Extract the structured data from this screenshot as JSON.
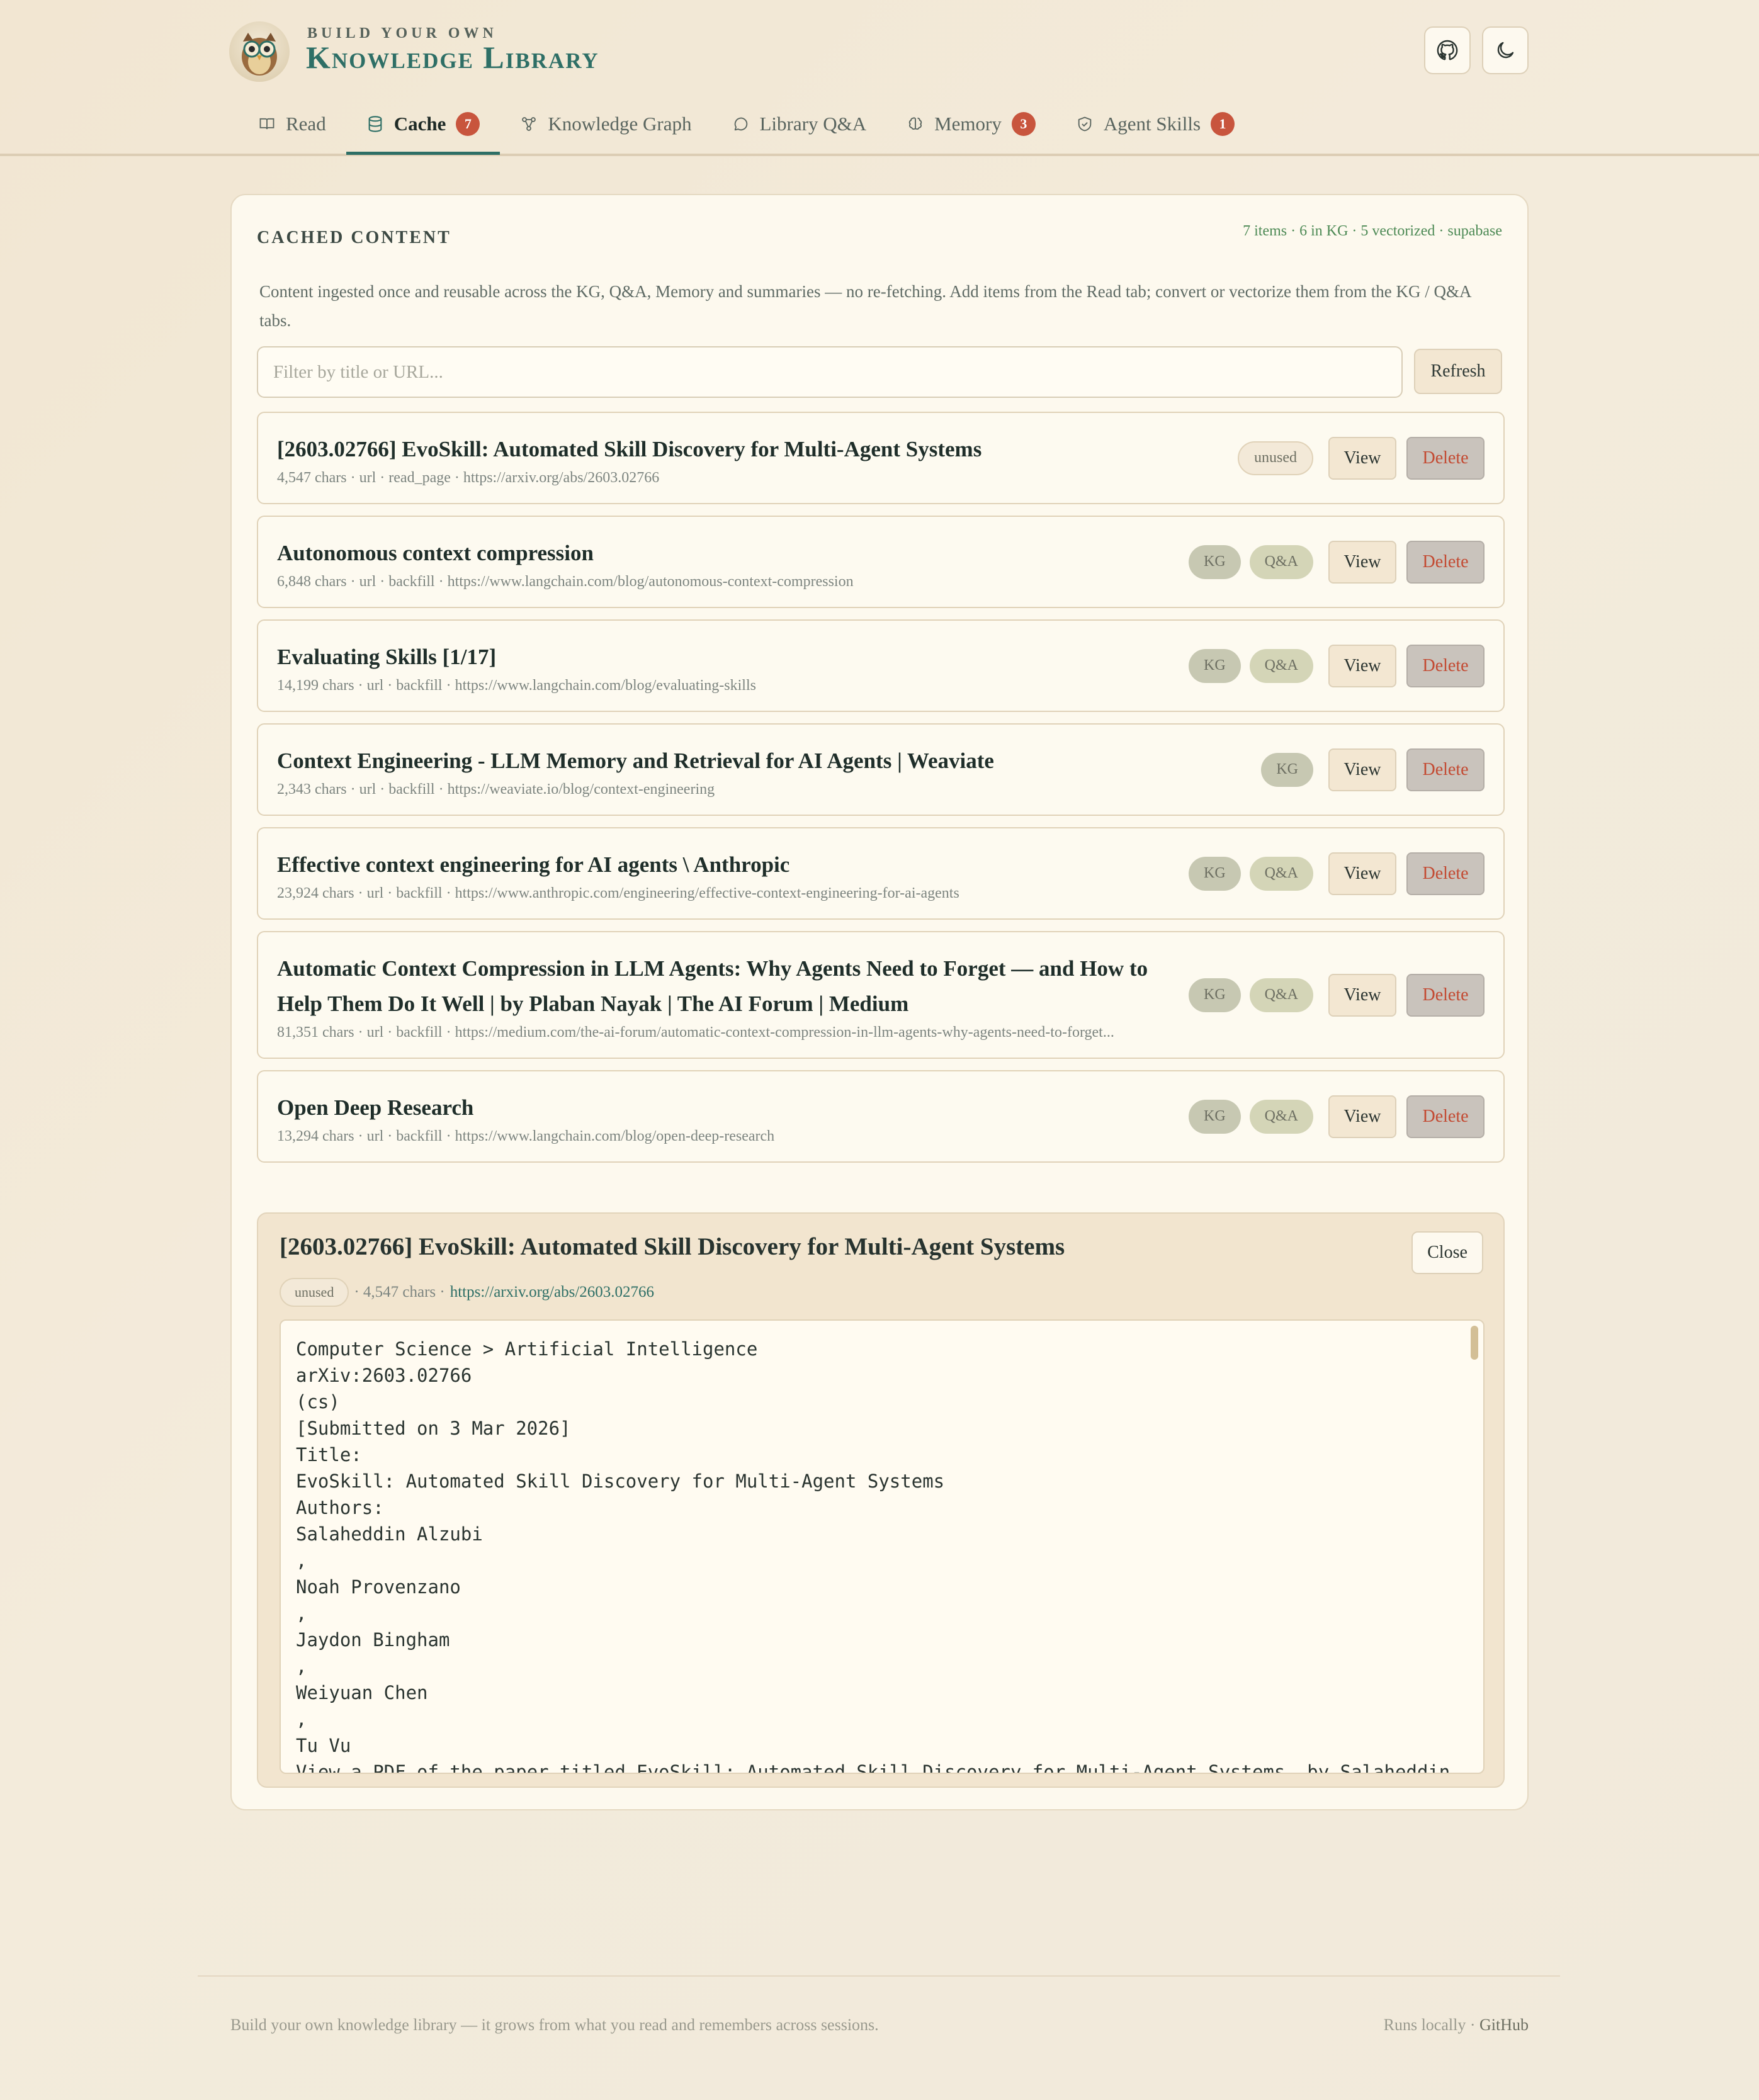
{
  "brand": {
    "subtitle": "BUILD YOUR OWN",
    "title": "Knowledge Library"
  },
  "header_icons": [
    "github-icon",
    "moon-icon"
  ],
  "tabs": [
    {
      "label": "Read",
      "icon": "book-icon",
      "badge": null,
      "active": false
    },
    {
      "label": "Cache",
      "icon": "database-icon",
      "badge": "7",
      "active": true
    },
    {
      "label": "Knowledge Graph",
      "icon": "graph-icon",
      "badge": null,
      "active": false
    },
    {
      "label": "Library Q&A",
      "icon": "chat-icon",
      "badge": null,
      "active": false
    },
    {
      "label": "Memory",
      "icon": "brain-icon",
      "badge": "3",
      "active": false
    },
    {
      "label": "Agent Skills",
      "icon": "shield-icon",
      "badge": "1",
      "active": false
    }
  ],
  "cache": {
    "title": "CACHED CONTENT",
    "stats": "7 items · 6 in KG · 5 vectorized · supabase",
    "description": "Content ingested once and reusable across the KG, Q&A, Memory and summaries — no re-fetching. Add items from the Read tab; convert or vectorize them from the KG / Q&A tabs.",
    "filter_placeholder": "Filter by title or URL...",
    "refresh_label": "Refresh",
    "view_label": "View",
    "delete_label": "Delete",
    "items": [
      {
        "title": "[2603.02766] EvoSkill: Automated Skill Discovery for Multi-Agent Systems",
        "meta": "4,547 chars · url · read_page · https://arxiv.org/abs/2603.02766",
        "tags": [
          "unused"
        ]
      },
      {
        "title": "Autonomous context compression",
        "meta": "6,848 chars · url · backfill · https://www.langchain.com/blog/autonomous-context-compression",
        "tags": [
          "KG",
          "Q&A"
        ]
      },
      {
        "title": "Evaluating Skills [1/17]",
        "meta": "14,199 chars · url · backfill · https://www.langchain.com/blog/evaluating-skills",
        "tags": [
          "KG",
          "Q&A"
        ]
      },
      {
        "title": "Context Engineering - LLM Memory and Retrieval for AI Agents | Weaviate",
        "meta": "2,343 chars · url · backfill · https://weaviate.io/blog/context-engineering",
        "tags": [
          "KG"
        ]
      },
      {
        "title": "Effective context engineering for AI agents \\ Anthropic",
        "meta": "23,924 chars · url · backfill · https://www.anthropic.com/engineering/effective-context-engineering-for-ai-agents",
        "tags": [
          "KG",
          "Q&A"
        ]
      },
      {
        "title": "Automatic Context Compression in LLM Agents: Why Agents Need to Forget — and How to Help Them Do It Well | by Plaban Nayak | The AI Forum | Medium",
        "meta": "81,351 chars · url · backfill · https://medium.com/the-ai-forum/automatic-context-compression-in-llm-agents-why-agents-need-to-forget...",
        "tags": [
          "KG",
          "Q&A"
        ]
      },
      {
        "title": "Open Deep Research",
        "meta": "13,294 chars · url · backfill · https://www.langchain.com/blog/open-deep-research",
        "tags": [
          "KG",
          "Q&A"
        ]
      }
    ]
  },
  "detail": {
    "title": "[2603.02766] EvoSkill: Automated Skill Discovery for Multi-Agent Systems",
    "close_label": "Close",
    "tag": "unused",
    "chars": "· 4,547 chars ·",
    "url": "https://arxiv.org/abs/2603.02766",
    "content": "Computer Science > Artificial Intelligence\narXiv:2603.02766\n(cs)\n[Submitted on 3 Mar 2026]\nTitle:\nEvoSkill: Automated Skill Discovery for Multi-Agent Systems\nAuthors:\nSalaheddin Alzubi\n,\nNoah Provenzano\n,\nJaydon Bingham\n,\nWeiyuan Chen\n,\nTu Vu\nView a PDF of the paper titled EvoSkill: Automated Skill Discovery for Multi-Agent Systems, by Salaheddin"
  },
  "footer": {
    "left": "Build your own knowledge library — it grows from what you read and remembers across sessions.",
    "right_prefix": "Runs locally · ",
    "right_link": "GitHub"
  },
  "colors": {
    "accent": "#2e6f66",
    "badge": "#c8553d",
    "delete_text": "#c34a32",
    "stats_green": "#4d8a55"
  }
}
